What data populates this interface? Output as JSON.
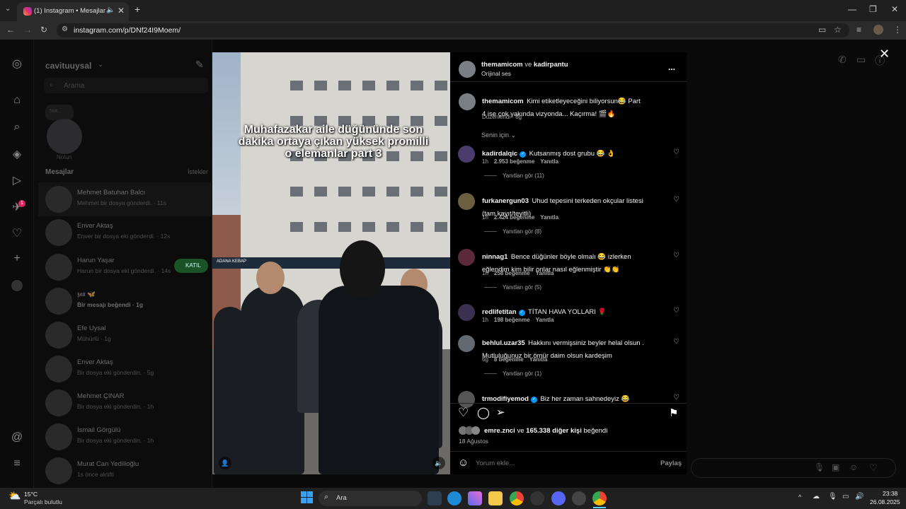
{
  "browser": {
    "tab_title": "(1) Instagram • Mesajlar",
    "url": "instagram.com/p/DNf24I9Moem/"
  },
  "sidebar_dm": {
    "username": "cavituuysal",
    "search_placeholder": "Arama",
    "note_label": "Not...",
    "note_owner": "Notun",
    "messages_title": "Mesajlar",
    "requests_label": "İstekler",
    "call_badge": "KATIL",
    "conversations": [
      {
        "name": "Mehmet Batuhan Balcı",
        "msg": "Mehmet bir dosya gönderdi. · 11s",
        "bold": false
      },
      {
        "name": "Enver Aktaş",
        "msg": "Enver bir dosya eki gönderdi. · 12s",
        "bold": false
      },
      {
        "name": "Harun Yaşar",
        "msg": "Harun bir dosya eki gönderdi. · 14s",
        "bold": false
      },
      {
        "name": "𝖟𝖆𝖝 🦋",
        "msg": "Bir mesajı beğendi · 1g",
        "bold": true
      },
      {
        "name": "Efe Uysal",
        "msg": "Mühürlü · 1g",
        "bold": false
      },
      {
        "name": "Enver Aktaş",
        "msg": "Bir dosya eki gönderdin. · 5g",
        "bold": false
      },
      {
        "name": "Mehmet ÇINAR",
        "msg": "Bir dosya eki gönderdin. · 1h",
        "bold": false
      },
      {
        "name": "İsmail Görgülü",
        "msg": "Bir dosya eki gönderdin. · 1h",
        "bold": false
      },
      {
        "name": "Murat Can Yedilioğlu",
        "msg": "1s önce aktifti",
        "bold": false
      }
    ]
  },
  "video": {
    "caption": "Muhafazakar aile düğününde son dakika ortaya çıkan yüksek promilli o elemanlar part 3",
    "storefront_text": "ADANA KEBAP"
  },
  "post": {
    "author_line_user1": "themamicom",
    "author_line_joiner": "ve",
    "author_line_user2": "kadirpantu",
    "audio_label": "Orijinal ses",
    "more_icon": "...",
    "caption_user": "themamicom",
    "caption_text": "Kimi etiketleyeceğini biliyorsun😂 Part 4 ise çok yakında vizyonda... Kaçırma! 🎬🔥",
    "caption_meta": "Düzenlendi · 6g",
    "sort_label": "Senin için",
    "comments": [
      {
        "user": "kadirdalqic",
        "verified": true,
        "text": "Kutsanmış dost grubu 😂 👌",
        "time": "1h",
        "likes": "2.953 beğenme",
        "reply": "Yanıtla",
        "replies": "Yanıtları gör (11)"
      },
      {
        "user": "furkanergun03",
        "verified": false,
        "text": "Uhud tepesini terkeden okçular listesi (tam kayıt/teyitli)",
        "time": "1h",
        "likes": "2.424 beğenme",
        "reply": "Yanıtla",
        "replies": "Yanıtları gör (8)"
      },
      {
        "user": "ninnag1",
        "verified": false,
        "text": "Bence düğünler böyle olmalı 😂 izlerken eğlendim kim bilir onlar nasıl eğlenmiştir 👏👏",
        "time": "1h",
        "likes": "258 beğenme",
        "reply": "Yanıtla",
        "replies": "Yanıtları gör (5)"
      },
      {
        "user": "redlifetitan",
        "verified": true,
        "text": "TİTAN HAVA YOLLARI 🌹",
        "time": "1h",
        "likes": "198 beğenme",
        "reply": "Yanıtla",
        "replies": ""
      },
      {
        "user": "behlul.uzar35",
        "verified": false,
        "text": "Hakkını vermişsiniz beyler helal olsun . Mutluluğunuz bir ömür daim olsun kardeşim",
        "time": "6g",
        "likes": "8 beğenme",
        "reply": "Yanıtla",
        "replies": "Yanıtları gör (1)"
      },
      {
        "user": "trmodifiyemod",
        "verified": true,
        "text": "Biz her zaman sahnedeyiz 😂",
        "time": "",
        "likes": "",
        "reply": "",
        "replies": ""
      }
    ],
    "liked_by_user": "emre.znci",
    "liked_by_joiner": "ve",
    "liked_by_count": "165.338 diğer kişi",
    "liked_by_suffix": "beğendi",
    "post_date": "18 Ağustos",
    "comment_placeholder": "Yorum ekle...",
    "share_label": "Paylaş"
  },
  "taskbar": {
    "weather_temp": "15°C",
    "weather_desc": "Parçalı bulutlu",
    "search_label": "Ara",
    "time": "23:38",
    "date": "26.08.2025"
  },
  "colors": {
    "accent_blue": "#0095f6",
    "join_green": "#2aa84a",
    "badge_red": "#e0245e"
  }
}
